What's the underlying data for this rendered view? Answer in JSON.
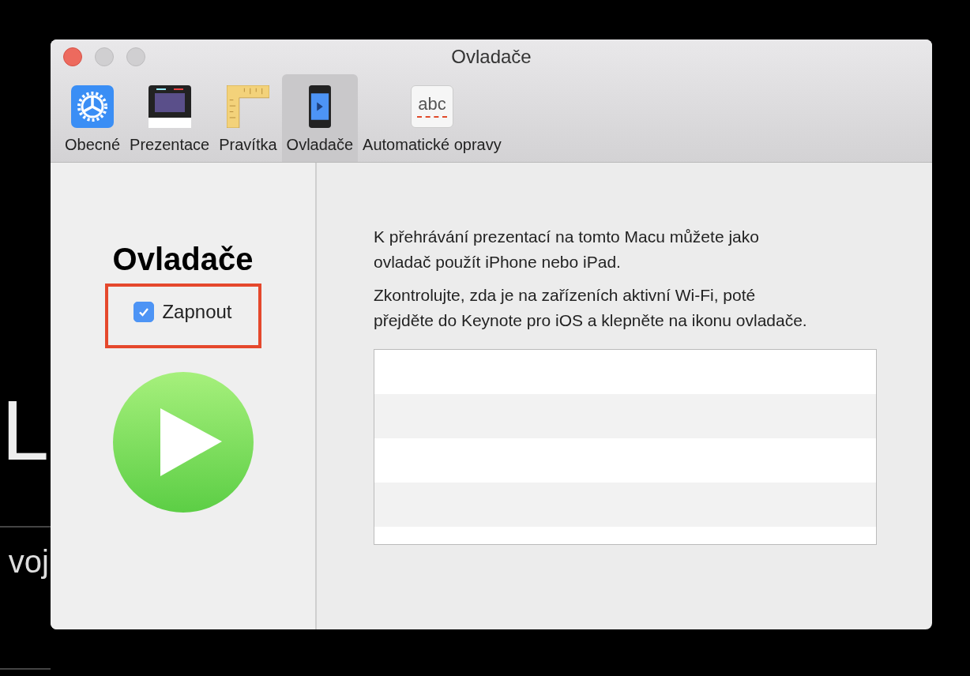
{
  "backdrop": {
    "letter": "L",
    "word": "voj"
  },
  "window": {
    "title": "Ovladače"
  },
  "toolbar": [
    {
      "label": "Obecné",
      "kind": "gear",
      "selected": false
    },
    {
      "label": "Prezentace",
      "kind": "display",
      "selected": false
    },
    {
      "label": "Pravítka",
      "kind": "ruler",
      "selected": false
    },
    {
      "label": "Ovladače",
      "kind": "phone",
      "selected": true
    },
    {
      "label": "Automatické opravy",
      "kind": "abc",
      "icon_text": "abc",
      "selected": false
    }
  ],
  "panel": {
    "heading": "Ovladače",
    "enable": {
      "label": "Zapnout",
      "checked": true,
      "highlighted": true
    }
  },
  "description": [
    "K přehrávání prezentací na tomto Macu můžete jako ovladač použít iPhone nebo iPad.",
    "Zkontrolujte, zda je na zařízeních aktivní Wi-Fi, poté přejděte do Keynote pro iOS a klepněte na ikonu ovladače."
  ]
}
